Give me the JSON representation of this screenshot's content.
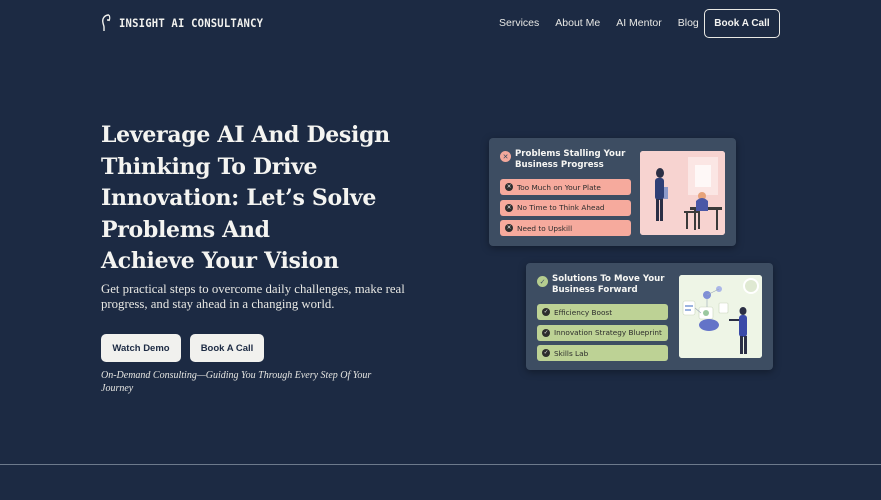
{
  "brand": {
    "name": "INSIGHT AI CONSULTANCY",
    "icon": "head-profile-icon"
  },
  "nav": {
    "links": [
      "Services",
      "About Me",
      "AI Mentor",
      "Blog"
    ],
    "cta": "Book A Call"
  },
  "hero": {
    "title_lines": [
      "Leverage AI And Design",
      "Thinking To Drive",
      "Innovation: Let’s Solve",
      "Problems And",
      "Achieve Your Vision"
    ],
    "subtitle": "Get practical steps to overcome daily challenges, make real progress, and stay ahead in a changing world.",
    "buttons": {
      "demo": "Watch Demo",
      "book": "Book A Call"
    },
    "tagline": "On-Demand Consulting—Guiding You Through Every Step Of Your Journey"
  },
  "problems_card": {
    "title": "Problems Stalling Your Business Progress",
    "icon": "x-circle-icon",
    "items": [
      "Too Much on Your Plate",
      "No Time to Think Ahead",
      "Need to Upskill"
    ]
  },
  "solutions_card": {
    "title": "Solutions To Move Your Business Forward",
    "icon": "check-circle-icon",
    "items": [
      "Efficiency Boost",
      "Innovation Strategy Blueprint",
      "Skills Lab"
    ]
  },
  "colors": {
    "background": "#1c2a43",
    "card": "#3d4d62",
    "problem_pill": "#f6aa9d",
    "solution_pill": "#bdd295"
  }
}
